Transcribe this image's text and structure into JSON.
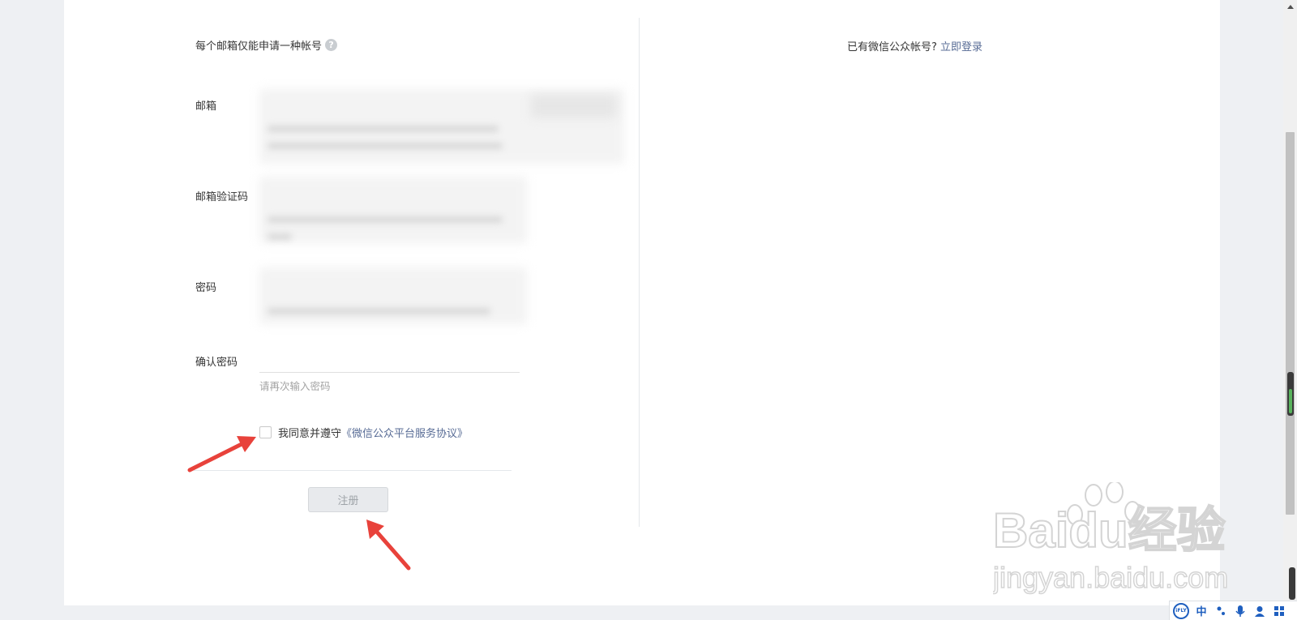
{
  "form": {
    "tip": "每个邮箱仅能申请一种帐号",
    "help_icon": "?",
    "email_label": "邮箱",
    "email_code_label": "邮箱验证码",
    "password_label": "密码",
    "confirm_password_label": "确认密码",
    "confirm_password_hint": "请再次输入密码",
    "agree_text": "我同意并遵守",
    "agree_link": "《微信公众平台服务协议》",
    "register_button": "注册"
  },
  "login": {
    "question": "已有微信公众帐号?",
    "link": "立即登录"
  },
  "watermark": {
    "brand": "Baidu经验",
    "url": "jingyan.baidu.com"
  },
  "ime": {
    "logo": "iFLY",
    "mode": "中",
    "icons": [
      "punctuation-icon",
      "microphone-icon",
      "user-icon",
      "grid-icon"
    ]
  },
  "colors": {
    "link": "#576b95",
    "arrow": "#e8423b",
    "button_bg": "#e8eaed"
  }
}
